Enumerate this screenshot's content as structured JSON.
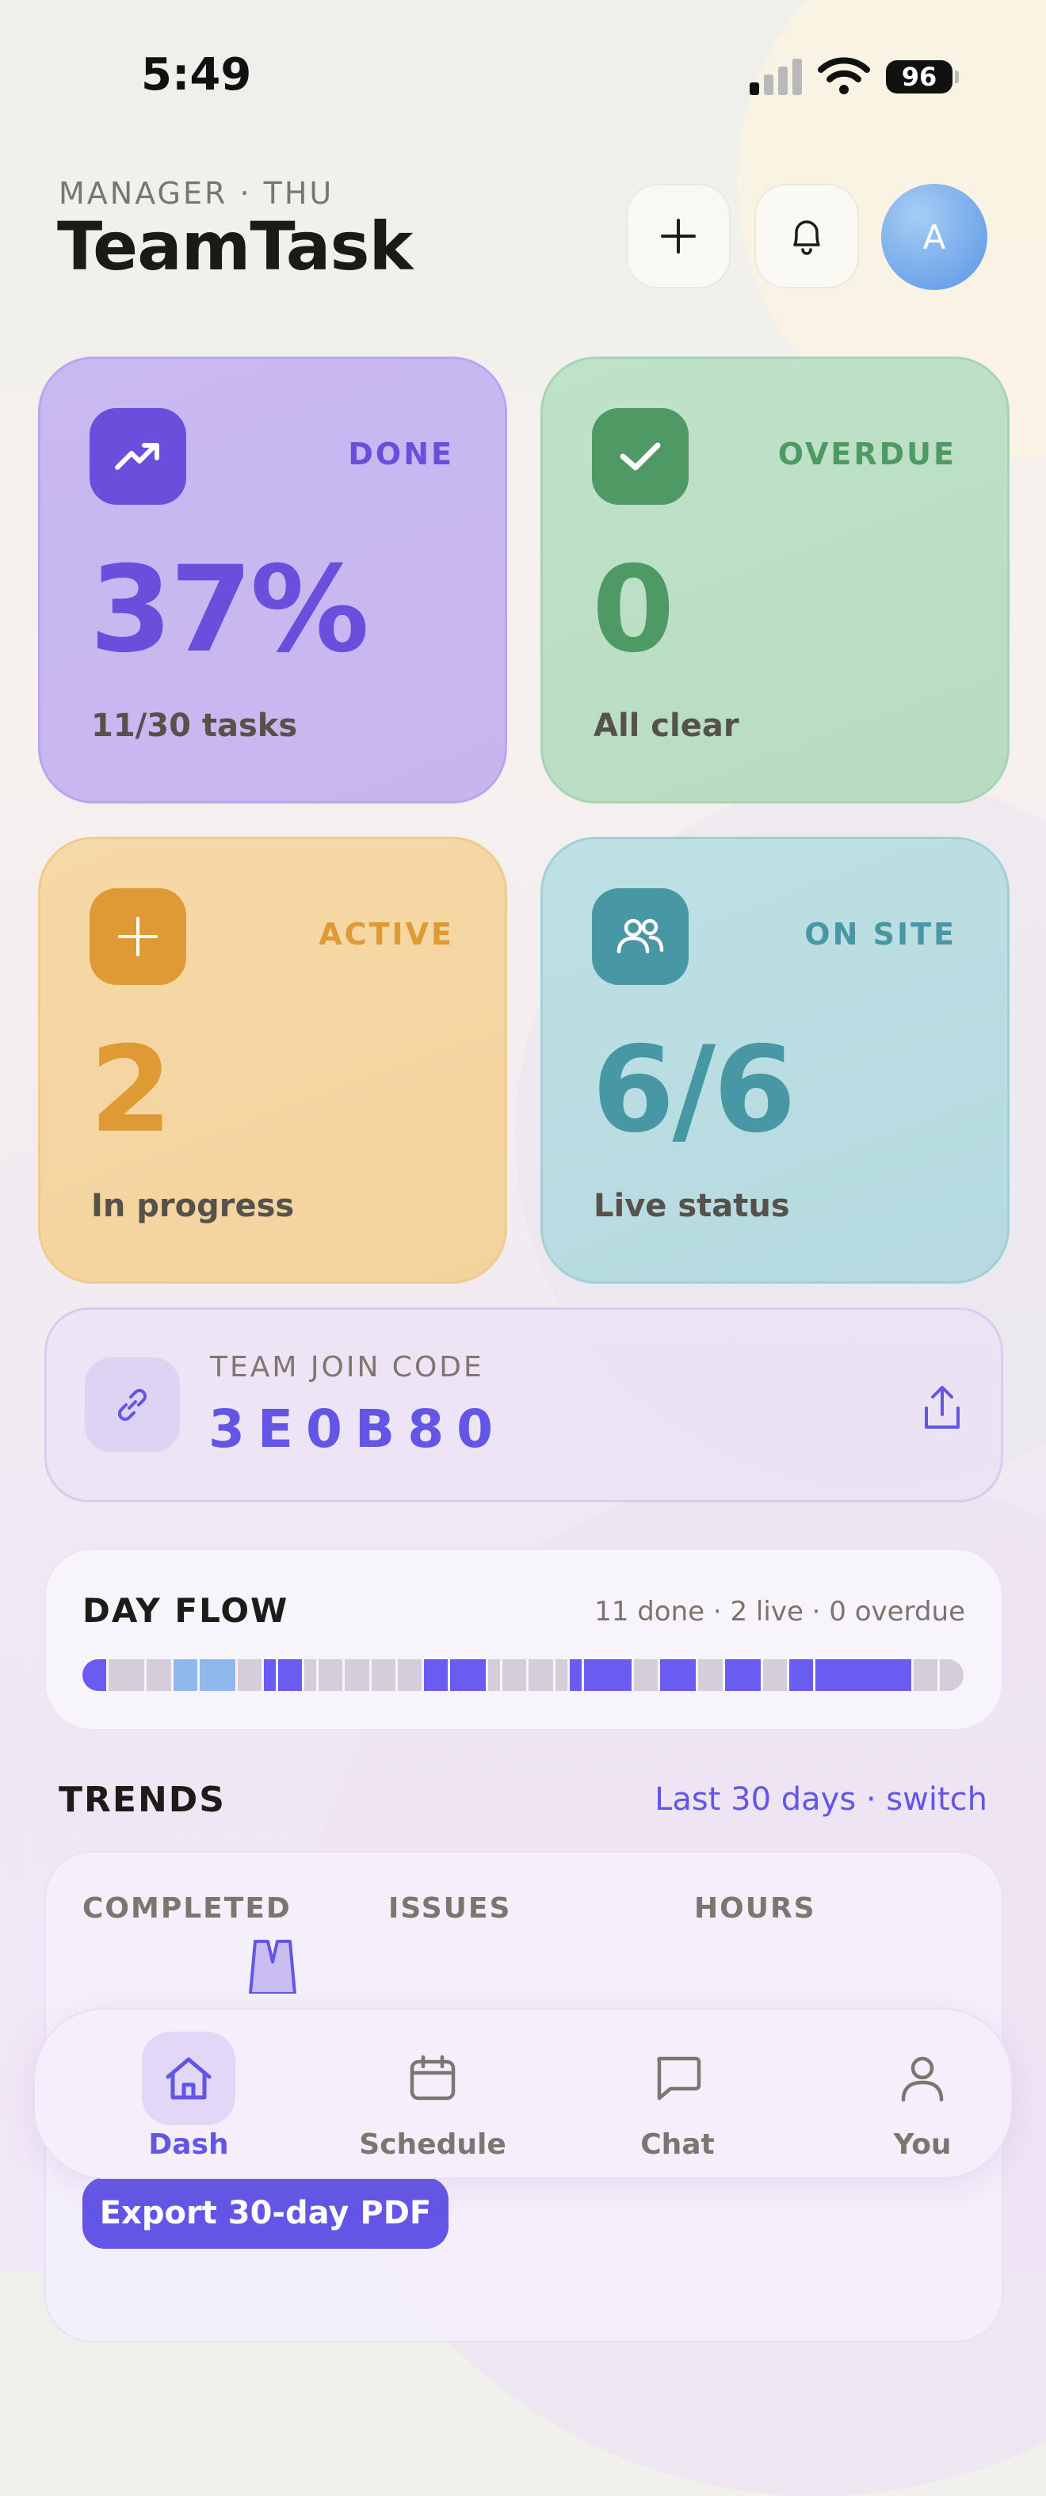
{
  "status_bar": {
    "time": "5:49",
    "battery": "96"
  },
  "header": {
    "subtitle": "MANAGER · THU",
    "title": "TeamTask",
    "avatar_initial": "A"
  },
  "stats": [
    {
      "label": "DONE",
      "value": "37%",
      "sub": "11/30 tasks",
      "color": "#6a4fdc",
      "icon": "trending-up-icon"
    },
    {
      "label": "OVERDUE",
      "value": "0",
      "sub": "All clear",
      "color": "#4f9a64",
      "icon": "check-icon"
    },
    {
      "label": "ACTIVE",
      "value": "2",
      "sub": "In progress",
      "color": "#e09a35",
      "icon": "plus-sparkle-icon"
    },
    {
      "label": "ON SITE",
      "value": "6/6",
      "sub": "Live status",
      "color": "#4897a4",
      "icon": "users-icon"
    }
  ],
  "join_code": {
    "label": "TEAM JOIN CODE",
    "code": "3E0B80"
  },
  "day_flow": {
    "title": "DAY FLOW",
    "summary": "11 done · 2 live · 0 overdue",
    "segments": [
      {
        "s": "done",
        "w": 2
      },
      {
        "s": "idle",
        "w": 3
      },
      {
        "s": "idle",
        "w": 2
      },
      {
        "s": "live",
        "w": 2
      },
      {
        "s": "live",
        "w": 3
      },
      {
        "s": "idle",
        "w": 2
      },
      {
        "s": "done",
        "w": 1
      },
      {
        "s": "done",
        "w": 2
      },
      {
        "s": "idle",
        "w": 1
      },
      {
        "s": "idle",
        "w": 2
      },
      {
        "s": "idle",
        "w": 2
      },
      {
        "s": "idle",
        "w": 2
      },
      {
        "s": "idle",
        "w": 2
      },
      {
        "s": "done",
        "w": 2
      },
      {
        "s": "done",
        "w": 3
      },
      {
        "s": "idle",
        "w": 1
      },
      {
        "s": "idle",
        "w": 2
      },
      {
        "s": "idle",
        "w": 2
      },
      {
        "s": "idle",
        "w": 1
      },
      {
        "s": "done",
        "w": 1
      },
      {
        "s": "done",
        "w": 4
      },
      {
        "s": "idle",
        "w": 2
      },
      {
        "s": "done",
        "w": 3
      },
      {
        "s": "idle",
        "w": 2
      },
      {
        "s": "done",
        "w": 3
      },
      {
        "s": "idle",
        "w": 2
      },
      {
        "s": "done",
        "w": 2
      },
      {
        "s": "done",
        "w": 8
      },
      {
        "s": "idle",
        "w": 2
      },
      {
        "s": "idle",
        "w": 2
      }
    ],
    "colors": {
      "done": "#6a5cf0",
      "live": "#8fb8ec",
      "idle": "#d4ceda"
    }
  },
  "trends": {
    "title": "TRENDS",
    "range_link": "Last 30 days · switch",
    "columns": [
      "COMPLETED",
      "ISSUES",
      "HOURS"
    ],
    "export_label": "Export 30-day PDF"
  },
  "tabs": [
    {
      "label": "Dash",
      "icon": "home-icon",
      "active": true
    },
    {
      "label": "Schedule",
      "icon": "calendar-icon",
      "active": false
    },
    {
      "label": "Chat",
      "icon": "chat-icon",
      "active": false
    },
    {
      "label": "You",
      "icon": "person-icon",
      "active": false
    }
  ]
}
